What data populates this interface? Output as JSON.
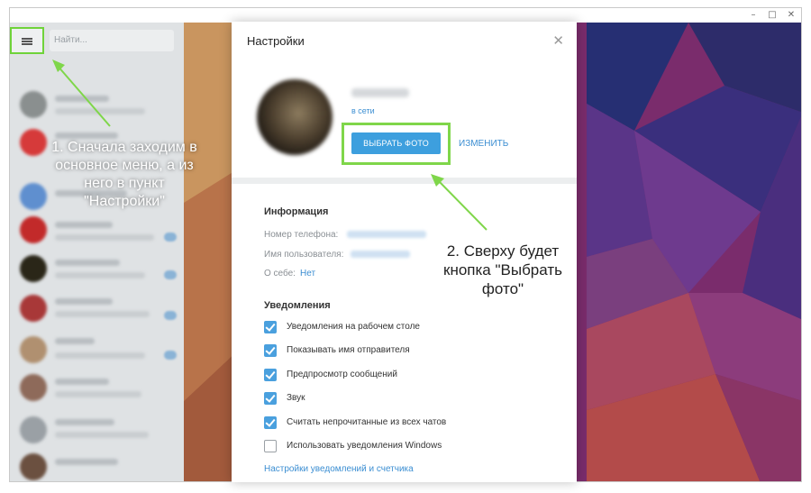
{
  "window": {
    "controls": {
      "minimize": "–",
      "maximize": "□",
      "close": "✕"
    }
  },
  "sidebar": {
    "menu_icon": "hamburger-menu-icon",
    "search_placeholder": "Найти..."
  },
  "settings": {
    "title": "Настройки",
    "close_icon": "close-icon",
    "profile": {
      "status": "в сети",
      "choose_photo": "ВЫБРАТЬ ФОТО",
      "change": "ИЗМЕНИТЬ"
    },
    "info": {
      "title": "Информация",
      "phone_label": "Номер телефона:",
      "username_label": "Имя пользователя:",
      "bio_label": "О себе:",
      "bio_value": "Нет"
    },
    "notifications": {
      "title": "Уведомления",
      "items": [
        {
          "label": "Уведомления на рабочем столе",
          "checked": true
        },
        {
          "label": "Показывать имя отправителя",
          "checked": true
        },
        {
          "label": "Предпросмотр сообщений",
          "checked": true
        },
        {
          "label": "Звук",
          "checked": true
        },
        {
          "label": "Считать непрочитанные из всех чатов",
          "checked": true
        },
        {
          "label": "Использовать уведомления Windows",
          "checked": false
        }
      ],
      "link": "Настройки уведомлений и счетчика"
    }
  },
  "annotations": {
    "step1": [
      "1. Сначала заходим в",
      "основное меню, а из",
      "него в пункт",
      "\"Настройки\""
    ],
    "step2": [
      "2. Сверху будет",
      "кнопка \"Выбрать",
      "фото\""
    ],
    "arrow_color": "#7fd64a"
  },
  "colors": {
    "accent": "#3d9fde",
    "highlight": "#7fd64a"
  }
}
